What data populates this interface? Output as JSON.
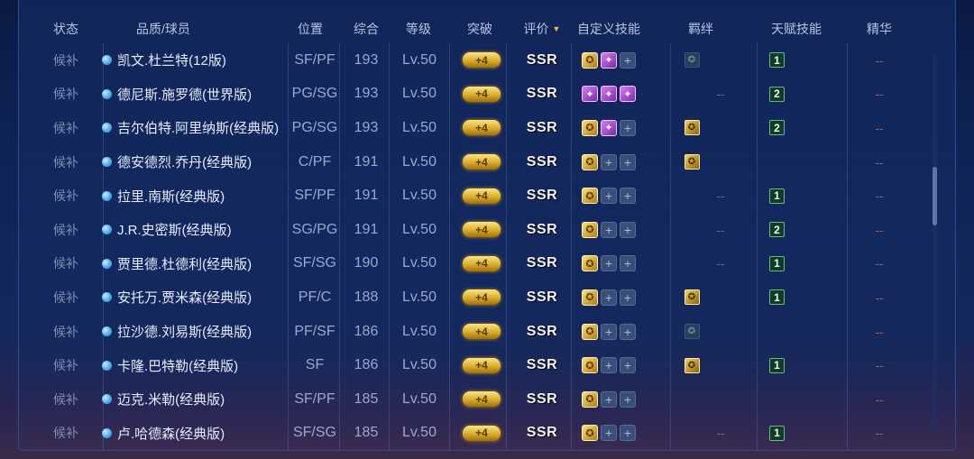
{
  "headers": {
    "status": "状态",
    "player": "品质/球员",
    "position": "位置",
    "overall": "综合",
    "level": "等级",
    "breakthrough": "突破",
    "rating": "评价",
    "custom_skills": "自定义技能",
    "bond": "羁绊",
    "talent": "天赋技能",
    "essence": "精华"
  },
  "colors": {
    "accent_gold": "#f0c23a",
    "talent_green": "#5cbf80",
    "dash": "#b05a3a"
  },
  "rows": [
    {
      "status": "候补",
      "name": "凯文.杜兰特(12版)",
      "position": "SF/PF",
      "overall": "193",
      "level": "Lv.50",
      "breakthrough": "+4",
      "rating": "SSR",
      "skills": [
        "gold",
        "purple",
        "empty"
      ],
      "bond": "dim",
      "bond_text": "",
      "talent": "1",
      "essence": "--"
    },
    {
      "status": "候补",
      "name": "德尼斯.施罗德(世界版)",
      "position": "PG/SG",
      "overall": "193",
      "level": "Lv.50",
      "breakthrough": "+4",
      "rating": "SSR",
      "skills": [
        "purple",
        "purple",
        "purple"
      ],
      "bond": "none",
      "bond_text": "--",
      "talent": "2",
      "essence": "--"
    },
    {
      "status": "候补",
      "name": "吉尔伯特.阿里纳斯(经典版)",
      "position": "PG/SG",
      "overall": "193",
      "level": "Lv.50",
      "breakthrough": "+4",
      "rating": "SSR",
      "skills": [
        "gold",
        "purple",
        "empty"
      ],
      "bond": "gold",
      "bond_text": "",
      "talent": "2",
      "essence": "--"
    },
    {
      "status": "候补",
      "name": "德安德烈.乔丹(经典版)",
      "position": "C/PF",
      "overall": "191",
      "level": "Lv.50",
      "breakthrough": "+4",
      "rating": "SSR",
      "skills": [
        "gold",
        "empty",
        "empty"
      ],
      "bond": "gold",
      "bond_text": "",
      "talent": "",
      "essence": "--"
    },
    {
      "status": "候补",
      "name": "拉里.南斯(经典版)",
      "position": "SF/PF",
      "overall": "191",
      "level": "Lv.50",
      "breakthrough": "+4",
      "rating": "SSR",
      "skills": [
        "gold",
        "empty",
        "empty"
      ],
      "bond": "none",
      "bond_text": "--",
      "talent": "1",
      "essence": "--"
    },
    {
      "status": "候补",
      "name": "J.R.史密斯(经典版)",
      "position": "SG/PG",
      "overall": "191",
      "level": "Lv.50",
      "breakthrough": "+4",
      "rating": "SSR",
      "skills": [
        "gold",
        "empty",
        "empty"
      ],
      "bond": "none",
      "bond_text": "--",
      "talent": "2",
      "essence": "--"
    },
    {
      "status": "候补",
      "name": "贾里德.杜德利(经典版)",
      "position": "SF/SG",
      "overall": "190",
      "level": "Lv.50",
      "breakthrough": "+4",
      "rating": "SSR",
      "skills": [
        "gold",
        "empty",
        "empty"
      ],
      "bond": "none",
      "bond_text": "--",
      "talent": "1",
      "essence": "--"
    },
    {
      "status": "候补",
      "name": "安托万.贾米森(经典版)",
      "position": "PF/C",
      "overall": "188",
      "level": "Lv.50",
      "breakthrough": "+4",
      "rating": "SSR",
      "skills": [
        "gold",
        "empty",
        "empty"
      ],
      "bond": "gold",
      "bond_text": "",
      "talent": "1",
      "essence": "--"
    },
    {
      "status": "候补",
      "name": "拉沙德.刘易斯(经典版)",
      "position": "PF/SF",
      "overall": "186",
      "level": "Lv.50",
      "breakthrough": "+4",
      "rating": "SSR",
      "skills": [
        "gold",
        "empty",
        "empty"
      ],
      "bond": "dim",
      "bond_text": "",
      "talent": "",
      "essence": "--"
    },
    {
      "status": "候补",
      "name": "卡隆.巴特勒(经典版)",
      "position": "SF",
      "overall": "186",
      "level": "Lv.50",
      "breakthrough": "+4",
      "rating": "SSR",
      "skills": [
        "gold",
        "empty",
        "empty"
      ],
      "bond": "gold",
      "bond_text": "",
      "talent": "1",
      "essence": "--"
    },
    {
      "status": "候补",
      "name": "迈克.米勒(经典版)",
      "position": "SF/PF",
      "overall": "185",
      "level": "Lv.50",
      "breakthrough": "+4",
      "rating": "SSR",
      "skills": [
        "gold",
        "empty",
        "empty"
      ],
      "bond": "none",
      "bond_text": "",
      "talent": "",
      "essence": "--"
    },
    {
      "status": "候补",
      "name": "卢.哈德森(经典版)",
      "position": "SF/SG",
      "overall": "185",
      "level": "Lv.50",
      "breakthrough": "+4",
      "rating": "SSR",
      "skills": [
        "gold",
        "empty",
        "empty"
      ],
      "bond": "none",
      "bond_text": "--",
      "talent": "1",
      "essence": "--"
    }
  ]
}
